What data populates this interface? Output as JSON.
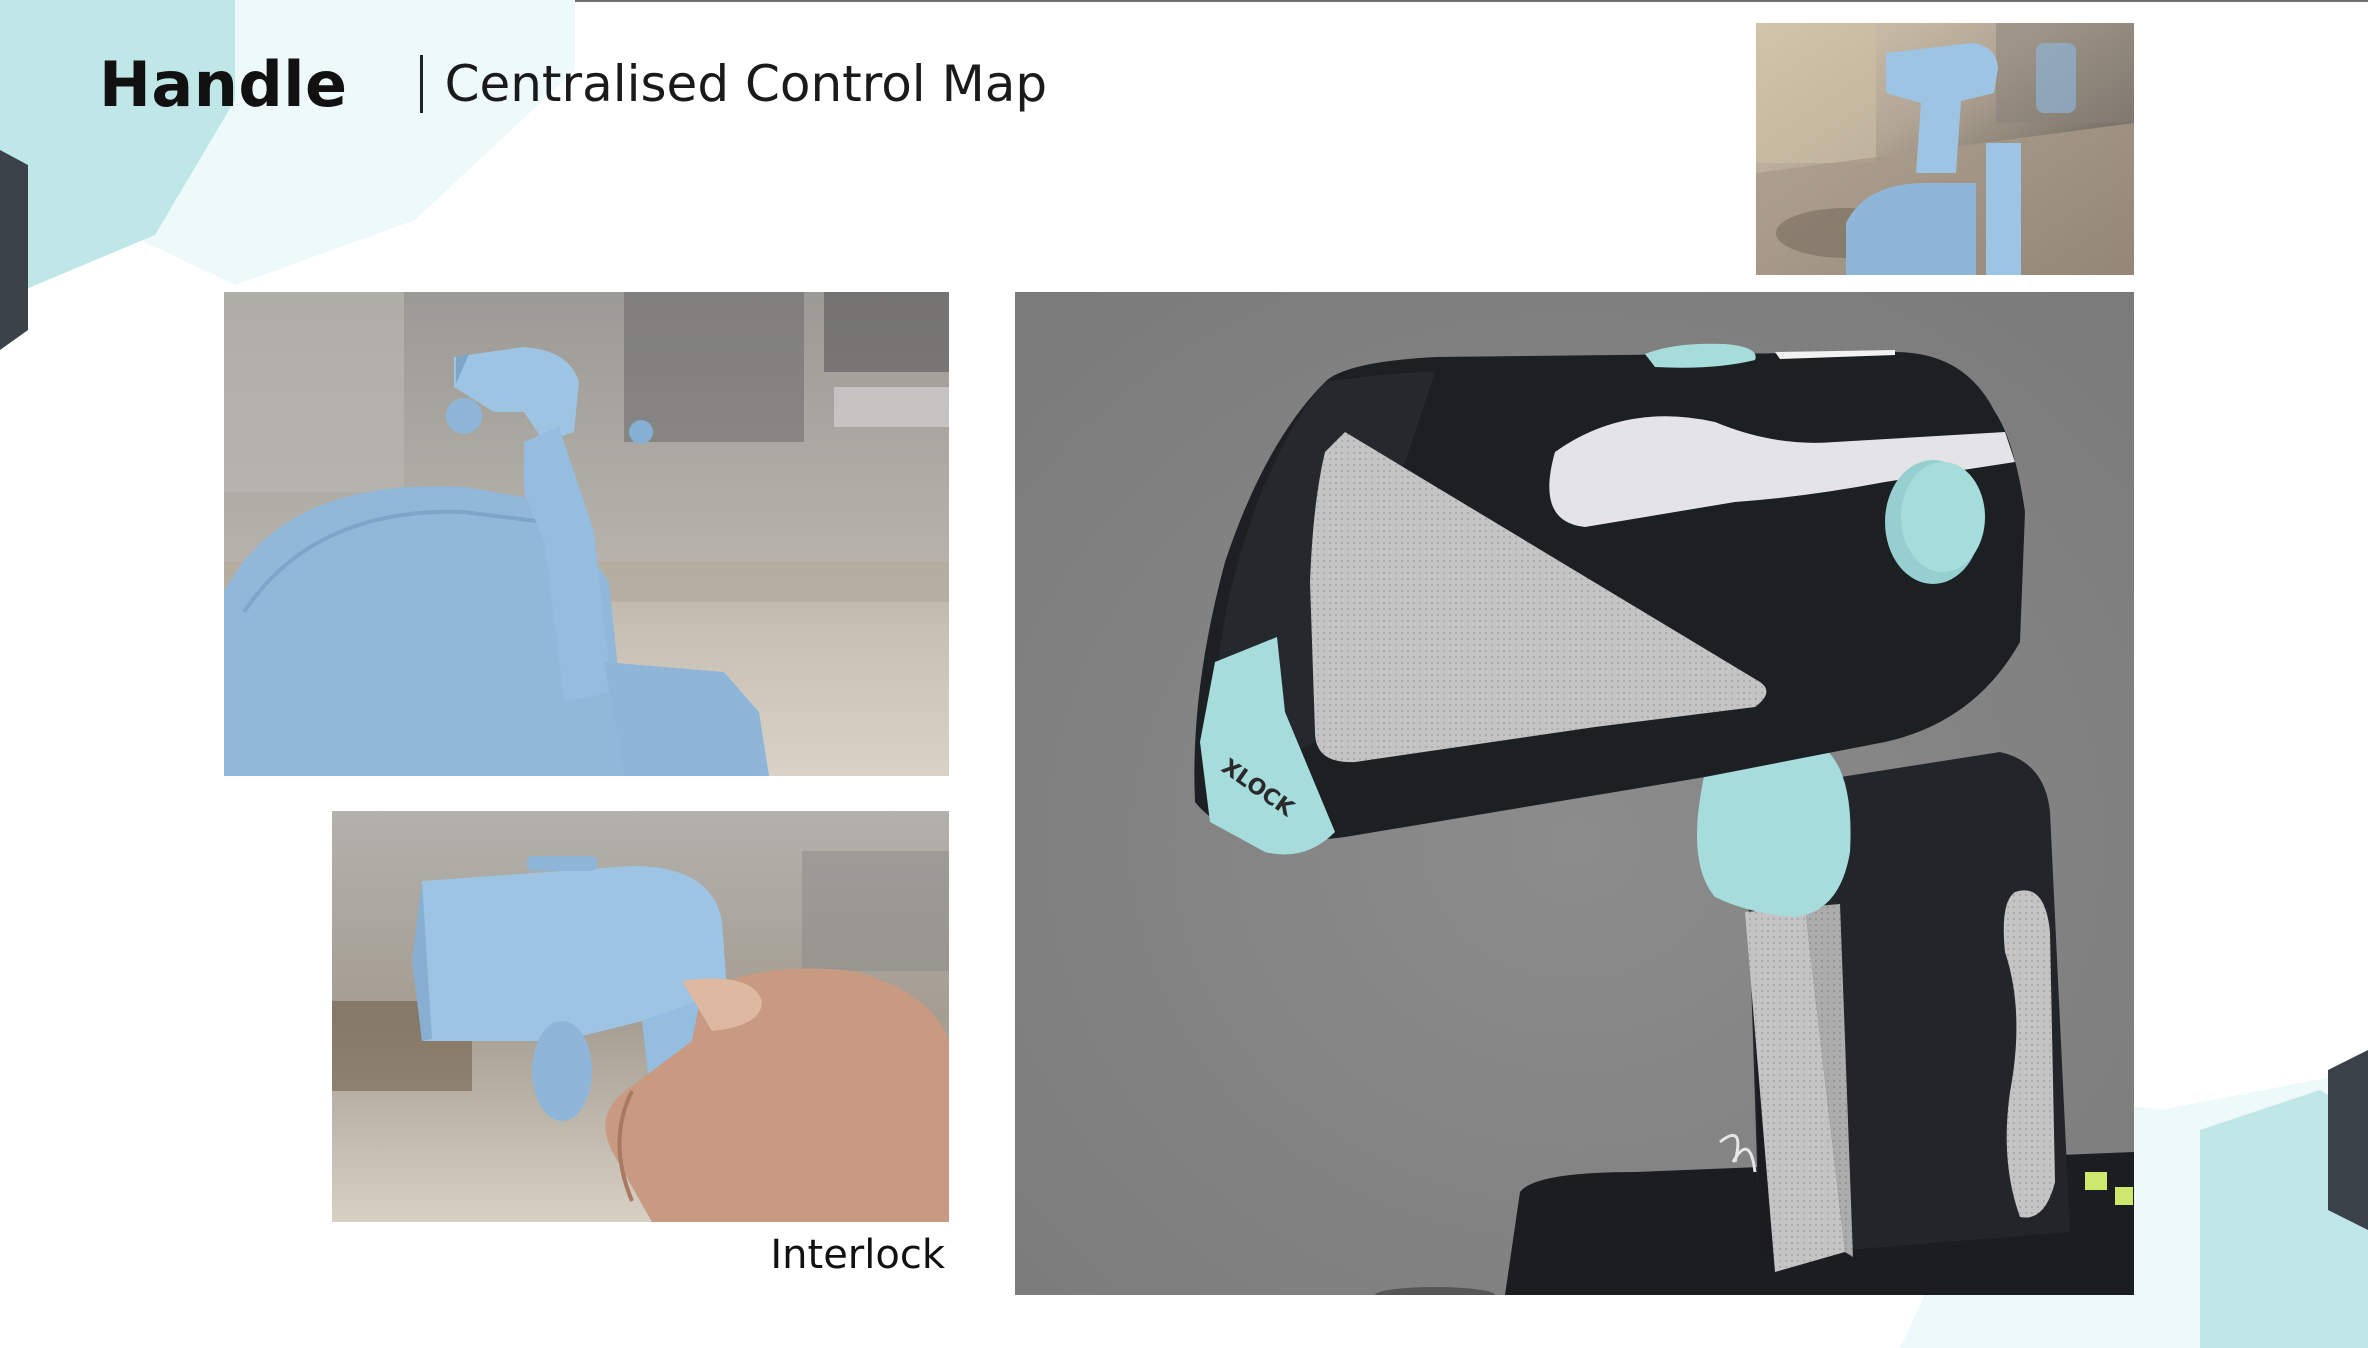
{
  "slide": {
    "title": "Handle",
    "subtitle": "Centralised Control Map"
  },
  "captions": {
    "interlock": "Interlock"
  },
  "render": {
    "lock_text": "XLOCK"
  },
  "colors": {
    "foam_blue": "#9ec4e4",
    "accent_teal": "#a6dcdc",
    "handle_black": "#1d2023",
    "render_background": "#8a8a8a",
    "deco_teal": "#bfe7e7"
  }
}
